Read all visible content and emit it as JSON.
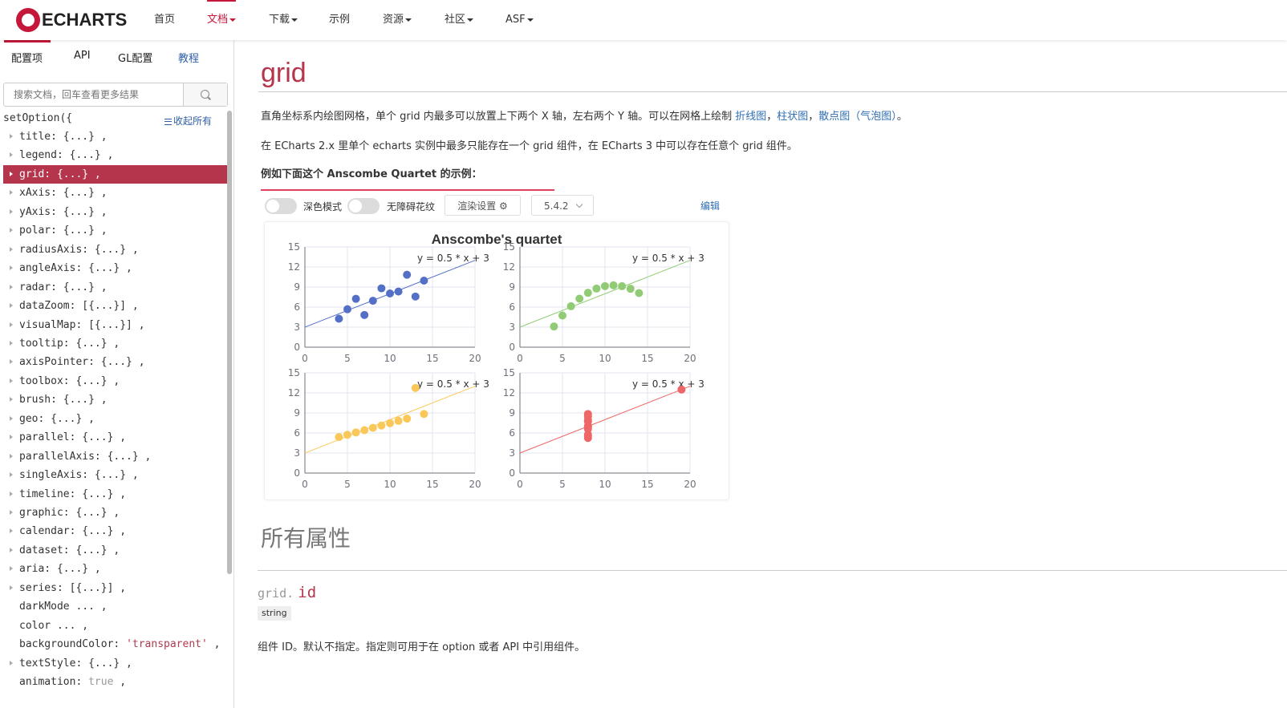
{
  "nav": {
    "logo_text": "ECHARTS",
    "items": [
      {
        "label": "首页",
        "dropdown": false,
        "active": false
      },
      {
        "label": "文档",
        "dropdown": true,
        "active": true
      },
      {
        "label": "下载",
        "dropdown": true,
        "active": false
      },
      {
        "label": "示例",
        "dropdown": false,
        "active": false
      },
      {
        "label": "资源",
        "dropdown": true,
        "active": false
      },
      {
        "label": "社区",
        "dropdown": true,
        "active": false
      },
      {
        "label": "ASF",
        "dropdown": true,
        "active": false
      }
    ]
  },
  "sidebar": {
    "tabs": [
      "配置项",
      "API",
      "GL配置",
      "教程"
    ],
    "search_placeholder": "搜索文档，回车查看更多结果",
    "root_label": "setOption({",
    "collapse_label": "收起所有",
    "tree": [
      {
        "text": "title: {...} ,",
        "arrow": true
      },
      {
        "text": "legend: {...} ,",
        "arrow": true
      },
      {
        "text": "grid: {...} ,",
        "arrow": true,
        "selected": true
      },
      {
        "text": "xAxis: {...} ,",
        "arrow": true
      },
      {
        "text": "yAxis: {...} ,",
        "arrow": true
      },
      {
        "text": "polar: {...} ,",
        "arrow": true
      },
      {
        "text": "radiusAxis: {...} ,",
        "arrow": true
      },
      {
        "text": "angleAxis: {...} ,",
        "arrow": true
      },
      {
        "text": "radar: {...} ,",
        "arrow": true
      },
      {
        "text": "dataZoom: [{...}] ,",
        "arrow": true
      },
      {
        "text": "visualMap: [{...}] ,",
        "arrow": true
      },
      {
        "text": "tooltip: {...} ,",
        "arrow": true
      },
      {
        "text": "axisPointer: {...} ,",
        "arrow": true
      },
      {
        "text": "toolbox: {...} ,",
        "arrow": true
      },
      {
        "text": "brush: {...} ,",
        "arrow": true
      },
      {
        "text": "geo: {...} ,",
        "arrow": true
      },
      {
        "text": "parallel: {...} ,",
        "arrow": true
      },
      {
        "text": "parallelAxis: {...} ,",
        "arrow": true
      },
      {
        "text": "singleAxis: {...} ,",
        "arrow": true
      },
      {
        "text": "timeline: {...} ,",
        "arrow": true
      },
      {
        "text": "graphic: {...} ,",
        "arrow": true
      },
      {
        "text": "calendar: {...} ,",
        "arrow": true
      },
      {
        "text": "dataset: {...} ,",
        "arrow": true
      },
      {
        "text": "aria: {...} ,",
        "arrow": true
      },
      {
        "text": "series: [{...}] ,",
        "arrow": true
      },
      {
        "text": "darkMode ... ,",
        "arrow": false
      },
      {
        "text": "color ... ,",
        "arrow": false
      },
      {
        "key": "backgroundColor: ",
        "value": "'transparent'",
        "suffix": " ,",
        "arrow": false
      },
      {
        "text": "textStyle: {...} ,",
        "arrow": true
      },
      {
        "key": "animation: ",
        "value": "true",
        "suffix": " ,",
        "arrow": false,
        "valueKind": "bool"
      }
    ]
  },
  "content": {
    "title": "grid",
    "desc1_text": "直角坐标系内绘图网格，单个 grid 内最多可以放置上下两个 X 轴，左右两个 Y 轴。可以在网格上绘制 ",
    "desc1_link1": "折线图",
    "desc1_sep1": "，",
    "desc1_link2": "柱状图",
    "desc1_sep2": "，",
    "desc1_link3": "散点图（气泡图）",
    "desc1_end": "。",
    "desc2": "在 ECharts 2.x 里单个 echarts 实例中最多只能存在一个 grid 组件，在 ECharts 3 中可以存在任意个 grid 组件。",
    "example_heading": "例如下面这个 Anscombe Quartet 的示例：",
    "controls": {
      "dark_mode_label": "深色模式",
      "aria_label": "无障碍花纹",
      "render_button": "渲染设置 ⚙",
      "version": "5.4.2",
      "edit": "编辑"
    },
    "section_heading": "所有属性",
    "property_prefix": "grid.",
    "property_name": "id",
    "property_type": "string",
    "property_desc": "组件 ID。默认不指定。指定则可用于在 option 或者 API 中引用组件。"
  },
  "chart_data": {
    "type": "scatter",
    "title": "Anscombe's quartet",
    "xlim": [
      0,
      20
    ],
    "ylim": [
      0,
      15
    ],
    "xticks": [
      0,
      5,
      10,
      15,
      20
    ],
    "yticks": [
      0,
      3,
      6,
      9,
      12,
      15
    ],
    "line_label": "y = 0.5 * x + 3",
    "line": {
      "slope": 0.5,
      "intercept": 3,
      "x_range": [
        0,
        20
      ]
    },
    "panels": [
      {
        "color": "#5470c6",
        "line_color": "#5470c6",
        "points": [
          [
            10,
            8.04
          ],
          [
            8,
            6.95
          ],
          [
            13,
            7.58
          ],
          [
            9,
            8.81
          ],
          [
            11,
            8.33
          ],
          [
            14,
            9.96
          ],
          [
            6,
            7.24
          ],
          [
            4,
            4.26
          ],
          [
            12,
            10.84
          ],
          [
            7,
            4.82
          ],
          [
            5,
            5.68
          ]
        ]
      },
      {
        "color": "#91cc75",
        "line_color": "#91cc75",
        "points": [
          [
            10,
            9.14
          ],
          [
            8,
            8.14
          ],
          [
            13,
            8.74
          ],
          [
            9,
            8.77
          ],
          [
            11,
            9.26
          ],
          [
            14,
            8.1
          ],
          [
            6,
            6.13
          ],
          [
            4,
            3.1
          ],
          [
            12,
            9.13
          ],
          [
            7,
            7.26
          ],
          [
            5,
            4.74
          ]
        ]
      },
      {
        "color": "#fac858",
        "line_color": "#fac858",
        "points": [
          [
            10,
            7.46
          ],
          [
            8,
            6.77
          ],
          [
            13,
            12.74
          ],
          [
            9,
            7.11
          ],
          [
            11,
            7.81
          ],
          [
            14,
            8.84
          ],
          [
            6,
            6.08
          ],
          [
            4,
            5.39
          ],
          [
            12,
            8.15
          ],
          [
            7,
            6.42
          ],
          [
            5,
            5.73
          ]
        ]
      },
      {
        "color": "#ee6666",
        "line_color": "#ee6666",
        "points": [
          [
            8,
            6.58
          ],
          [
            8,
            5.76
          ],
          [
            8,
            7.71
          ],
          [
            8,
            8.84
          ],
          [
            8,
            8.47
          ],
          [
            8,
            7.04
          ],
          [
            8,
            5.25
          ],
          [
            19,
            12.5
          ],
          [
            8,
            5.56
          ],
          [
            8,
            7.91
          ],
          [
            8,
            6.89
          ]
        ]
      }
    ]
  }
}
